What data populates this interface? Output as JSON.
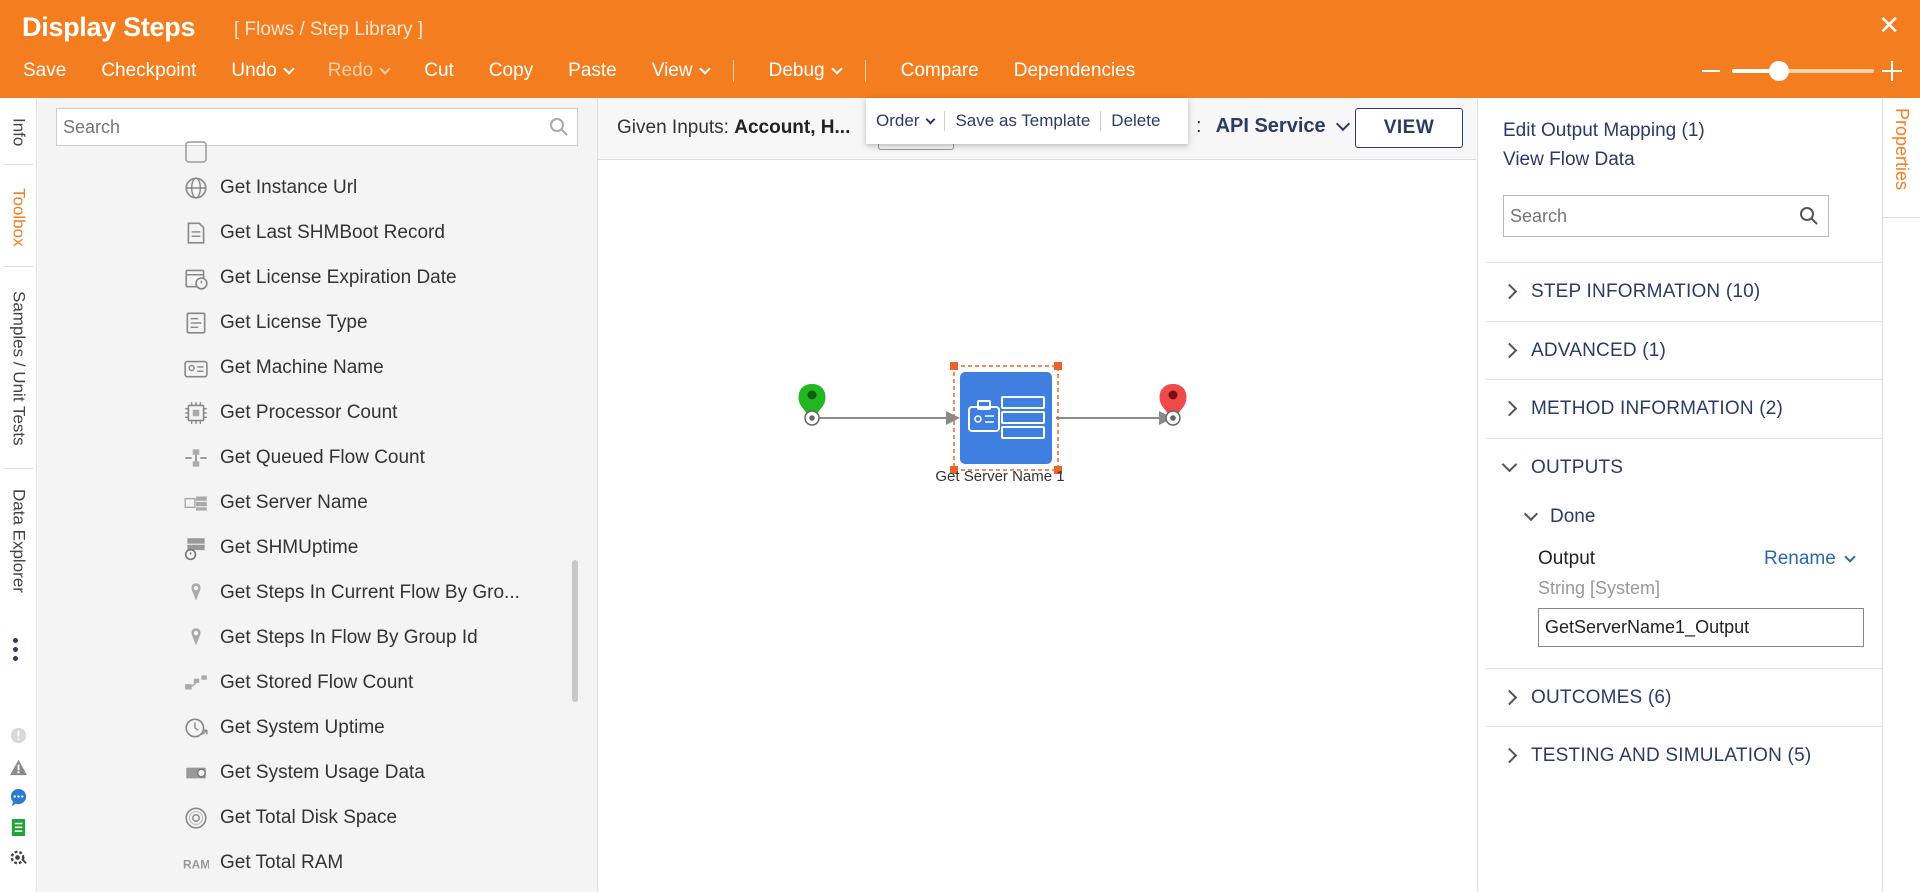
{
  "header": {
    "title": "Display Steps",
    "breadcrumb": "[ Flows / Step Library ]",
    "close": "✕",
    "toolbar": [
      {
        "label": "Save",
        "chevron": false,
        "disabled": false
      },
      {
        "label": "Checkpoint",
        "chevron": false,
        "disabled": false
      },
      {
        "label": "Undo",
        "chevron": true,
        "disabled": false
      },
      {
        "label": "Redo",
        "chevron": true,
        "disabled": true
      },
      {
        "label": "Cut",
        "chevron": false,
        "disabled": false
      },
      {
        "label": "Copy",
        "chevron": false,
        "disabled": false
      },
      {
        "label": "Paste",
        "chevron": false,
        "disabled": false
      },
      {
        "label": "View",
        "chevron": true,
        "disabled": false
      },
      {
        "label": "Debug",
        "chevron": true,
        "disabled": false
      },
      {
        "label": "Compare",
        "chevron": false,
        "disabled": false
      },
      {
        "label": "Dependencies",
        "chevron": false,
        "disabled": false
      }
    ]
  },
  "left_tabs": {
    "info": "Info",
    "toolbox": "Toolbox",
    "samples": "Samples / Unit Tests",
    "data_explorer": "Data Explorer"
  },
  "toolbox": {
    "search_placeholder": "Search",
    "items": [
      {
        "label": "Get Instance Url",
        "icon": "globe-icon"
      },
      {
        "label": "Get Last SHMBoot Record",
        "icon": "document-icon"
      },
      {
        "label": "Get License Expiration Date",
        "icon": "calendar-clock-icon"
      },
      {
        "label": "Get License Type",
        "icon": "license-icon"
      },
      {
        "label": "Get Machine Name",
        "icon": "id-card-icon"
      },
      {
        "label": "Get Processor Count",
        "icon": "chip-icon"
      },
      {
        "label": "Get Queued Flow Count",
        "icon": "queue-icon"
      },
      {
        "label": "Get Server Name",
        "icon": "server-icon"
      },
      {
        "label": "Get SHMUptime",
        "icon": "server-clock-icon"
      },
      {
        "label": "Get Steps In Current Flow By Gro...",
        "icon": "pin-icon"
      },
      {
        "label": "Get Steps In Flow By Group Id",
        "icon": "pin-icon"
      },
      {
        "label": "Get Stored Flow Count",
        "icon": "flow-count-icon"
      },
      {
        "label": "Get System Uptime",
        "icon": "clock-arrow-icon"
      },
      {
        "label": "Get System Usage Data",
        "icon": "gear-chip-icon"
      },
      {
        "label": "Get Total Disk Space",
        "icon": "disk-icon"
      },
      {
        "label": "Get Total RAM",
        "icon": "ram-icon"
      }
    ]
  },
  "canvas": {
    "given_label": "Given Inputs:",
    "given_value": "Account, H...",
    "service_prefix": ":",
    "service": "API Service",
    "view_button": "VIEW",
    "popover": {
      "order": "Order",
      "save_template": "Save as Template",
      "delete": "Delete"
    },
    "node_label": "Get Server Name 1",
    "colors": {
      "start": "#22b822",
      "end": "#f04a4a",
      "node": "#3f7fe0",
      "selection": "#e8662a"
    }
  },
  "properties": {
    "edit_mapping": "Edit Output Mapping (1)",
    "view_flow_data": "View Flow Data",
    "search_placeholder": "Search",
    "sections": [
      {
        "label": "STEP INFORMATION (10)",
        "expanded": false
      },
      {
        "label": "ADVANCED (1)",
        "expanded": false
      },
      {
        "label": "METHOD INFORMATION (2)",
        "expanded": false
      },
      {
        "label": "OUTPUTS",
        "expanded": true
      },
      {
        "label": "OUTCOMES (6)",
        "expanded": false
      },
      {
        "label": "TESTING AND SIMULATION (5)",
        "expanded": false
      }
    ],
    "done": "Done",
    "output_label": "Output",
    "rename": "Rename",
    "output_type": "String [System]",
    "output_value": "GetServerName1_Output",
    "tab": "Properties"
  }
}
